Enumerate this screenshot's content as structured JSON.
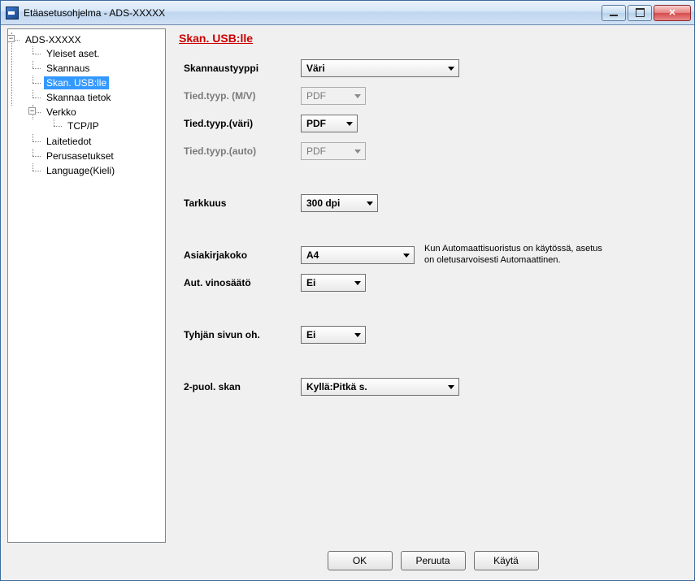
{
  "window": {
    "title": "Etäasetusohjelma - ADS-XXXXX"
  },
  "tree": {
    "root": {
      "label": "ADS-XXXXX",
      "toggle": "−",
      "children": [
        {
          "label": "Yleiset aset."
        },
        {
          "label": "Skannaus"
        },
        {
          "label": "Skan. USB:lle",
          "selected": true
        },
        {
          "label": "Skannaa tietok"
        },
        {
          "label": "Verkko",
          "toggle": "−",
          "children": [
            {
              "label": "TCP/IP"
            }
          ]
        },
        {
          "label": "Laitetiedot"
        },
        {
          "label": "Perusasetukset"
        },
        {
          "label": "Language(Kieli)"
        }
      ]
    }
  },
  "page": {
    "title": "Skan. USB:lle",
    "fields": {
      "scan_type": {
        "label": "Skannaustyyppi",
        "value": "Väri"
      },
      "file_type_bw": {
        "label": "Tied.tyyp. (M/V)",
        "value": "PDF",
        "disabled": true
      },
      "file_type_color": {
        "label": "Tied.tyyp.(väri)",
        "value": "PDF"
      },
      "file_type_auto": {
        "label": "Tied.tyyp.(auto)",
        "value": "PDF",
        "disabled": true
      },
      "resolution": {
        "label": "Tarkkuus",
        "value": "300 dpi"
      },
      "doc_size": {
        "label": "Asiakirjakoko",
        "value": "A4",
        "note": "Kun Automaattisuoristus on käytössä, asetus on oletusarvoisesti Automaattinen."
      },
      "auto_deskew": {
        "label": "Aut. vinosäätö",
        "value": "Ei"
      },
      "skip_blank": {
        "label": "Tyhjän sivun oh.",
        "value": "Ei"
      },
      "duplex": {
        "label": "2-puol. skan",
        "value": "Kyllä:Pitkä s."
      }
    }
  },
  "buttons": {
    "ok": "OK",
    "cancel": "Peruuta",
    "apply": "Käytä"
  }
}
